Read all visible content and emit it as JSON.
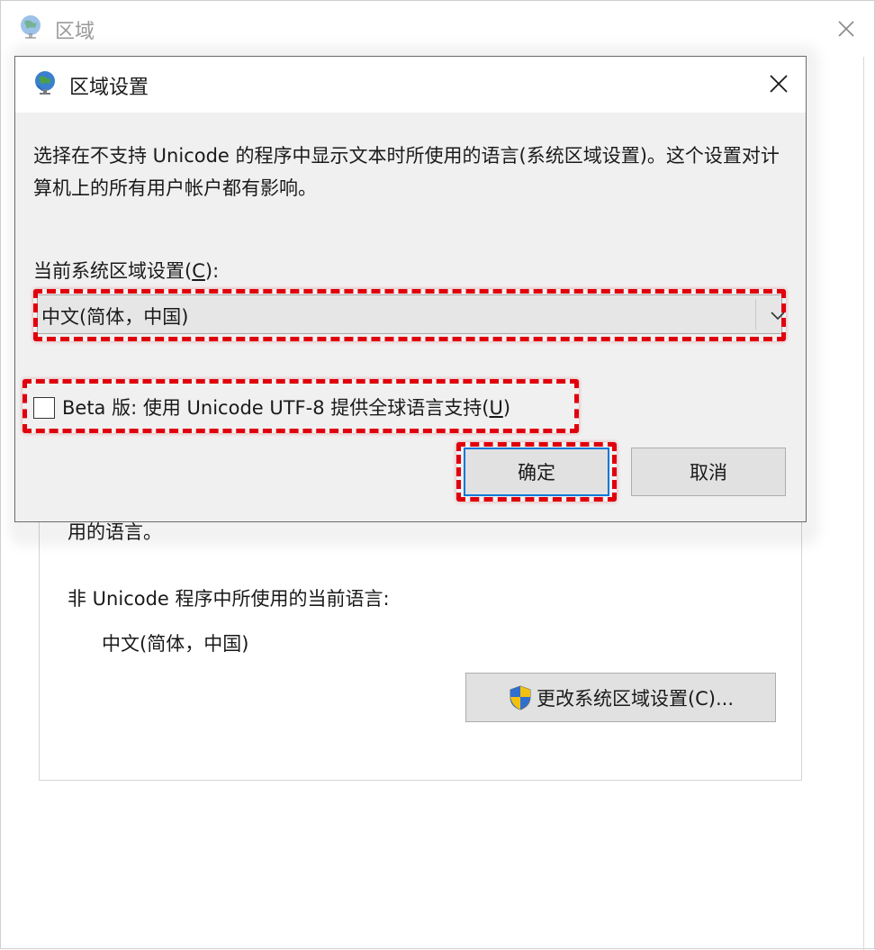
{
  "background_window": {
    "title": "区域",
    "partial_text": "用的语言。",
    "current_language_label": "非 Unicode 程序中所使用的当前语言:",
    "current_language_value": "中文(简体，中国)",
    "change_button_label": "更改系统区域设置(C)...",
    "icons": [
      "globe-icon",
      "close-icon",
      "shield-icon"
    ]
  },
  "dialog": {
    "title": "区域设置",
    "description": "选择在不支持 Unicode 的程序中显示文本时所使用的语言(系统区域设置)。这个设置对计算机上的所有用户帐户都有影响。",
    "locale_label_prefix": "当前系统区域设置(",
    "locale_label_key": "C",
    "locale_label_suffix": "):",
    "locale_selected": "中文(简体，中国)",
    "beta_checkbox_prefix": "Beta 版: 使用 Unicode UTF-8 提供全球语言支持(",
    "beta_checkbox_key": "U",
    "beta_checkbox_suffix": ")",
    "beta_checked": false,
    "ok_label": "确定",
    "cancel_label": "取消",
    "icons": [
      "globe-icon",
      "close-icon",
      "chevron-down-icon"
    ]
  },
  "colors": {
    "highlight": "#e0000d",
    "dialog_bg": "#f0f0f0",
    "button_bg": "#e1e1e1",
    "focus_border": "#0078d7"
  }
}
